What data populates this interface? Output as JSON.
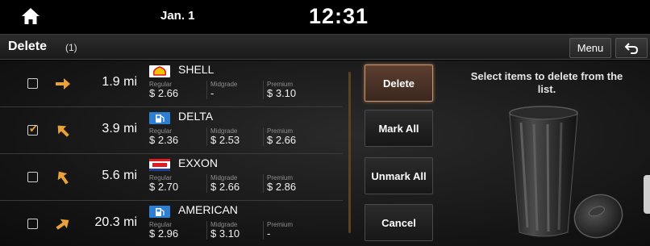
{
  "status": {
    "date": "Jan. 1",
    "time": "12:31"
  },
  "header": {
    "title": "Delete",
    "count": "(1)",
    "menu_label": "Menu"
  },
  "stations": [
    {
      "name": "SHELL",
      "distance": "1.9 mi",
      "checked": false,
      "direction": "right",
      "regular_label": "Regular",
      "regular": "$ 2.66",
      "mid_label": "Midgrade",
      "mid": "-",
      "premium_label": "Premium",
      "premium": "$ 3.10",
      "logo": "shell-logo"
    },
    {
      "name": "DELTA",
      "distance": "3.9 mi",
      "checked": true,
      "direction": "up-left",
      "regular_label": "Regular",
      "regular": "$ 2.36",
      "mid_label": "Midgrade",
      "mid": "$ 2.53",
      "premium_label": "Premium",
      "premium": "$ 2.66",
      "logo": "fuel-pump-logo"
    },
    {
      "name": "EXXON",
      "distance": "5.6 mi",
      "checked": false,
      "direction": "up-left",
      "regular_label": "Regular",
      "regular": "$ 2.70",
      "mid_label": "Midgrade",
      "mid": "$ 2.66",
      "premium_label": "Premium",
      "premium": "$ 2.86",
      "logo": "exxon-logo"
    },
    {
      "name": "AMERICAN",
      "distance": "20.3 mi",
      "checked": false,
      "direction": "up-right",
      "regular_label": "Regular",
      "regular": "$ 2.96",
      "mid_label": "Midgrade",
      "mid": "$ 3.10",
      "premium_label": "Premium",
      "premium": "-",
      "logo": "fuel-pump-logo"
    }
  ],
  "actions": {
    "delete": "Delete",
    "mark_all": "Mark All",
    "unmark_all": "Unmark All",
    "cancel": "Cancel"
  },
  "hint": "Select items to delete from the list.",
  "colors": {
    "accent": "#e9a23b",
    "primary_border": "#c9956b"
  }
}
